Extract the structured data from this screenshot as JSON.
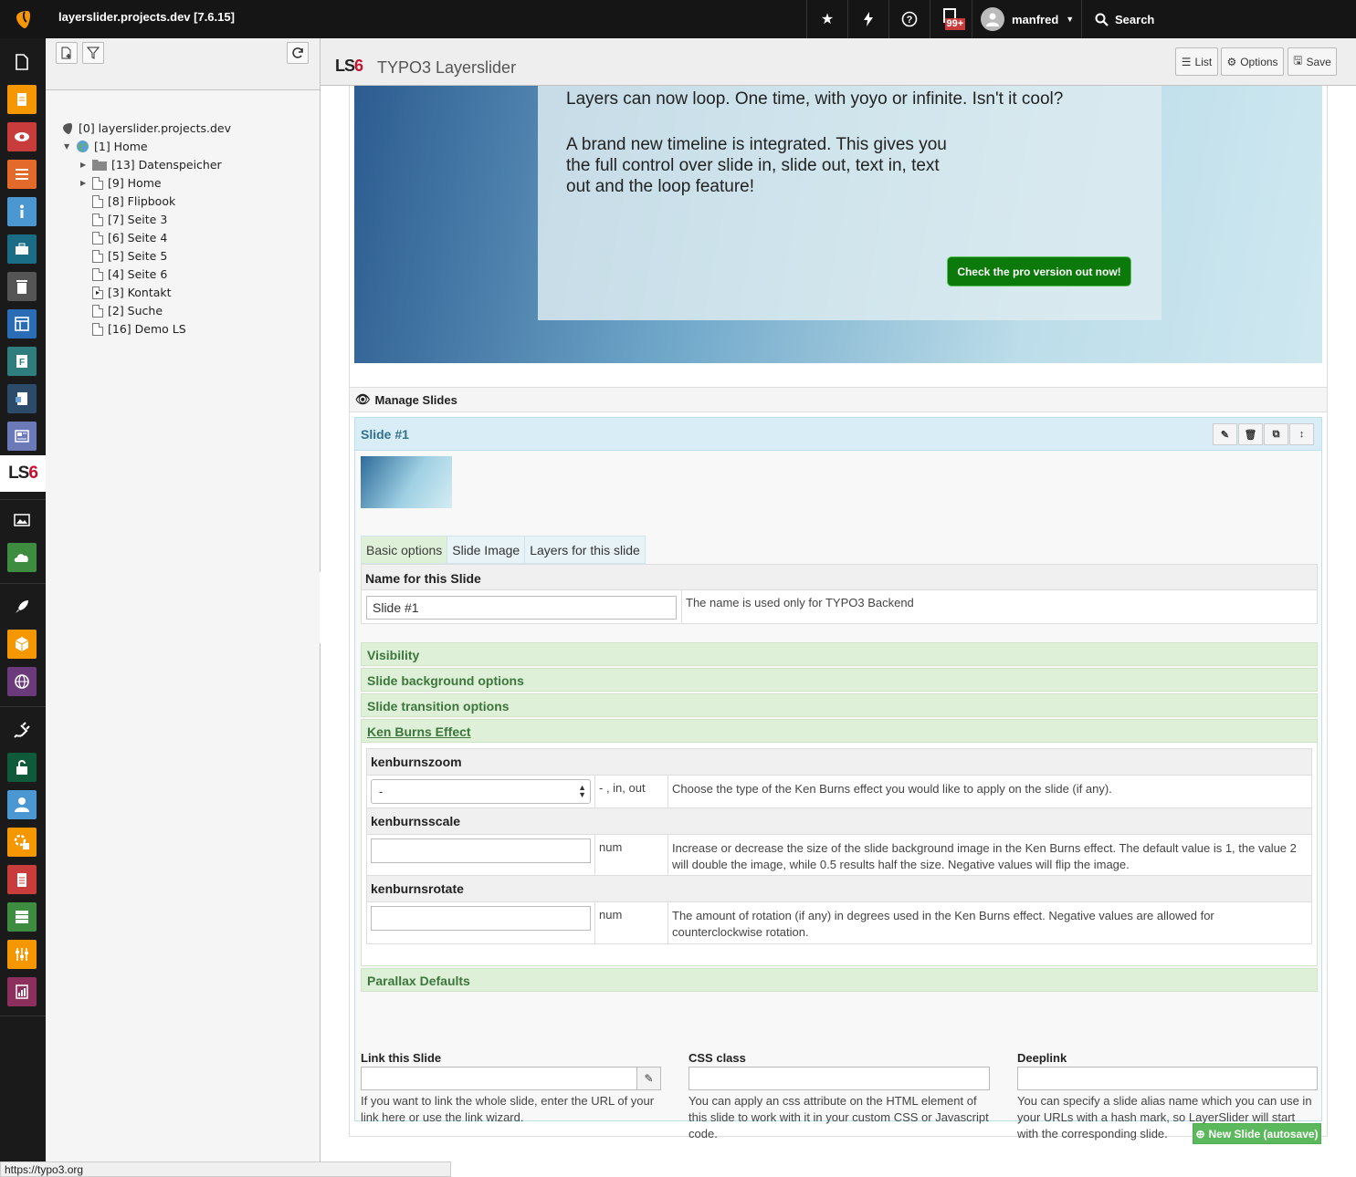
{
  "topbar": {
    "site_title": "layerslider.projects.dev [7.6.15]",
    "bookmark_icon": "star-icon",
    "cache_icon": "bolt-icon",
    "help_icon": "question-icon",
    "system_badge": "99+",
    "user_name": "manfred",
    "search_label": "Search"
  },
  "pagetree": {
    "root": "[0] layerslider.projects.dev",
    "items": [
      "[1] Home",
      "[13] Datenspeicher",
      "[9] Home",
      "[8] Flipbook",
      "[7] Seite 3",
      "[6] Seite 4",
      "[5] Seite 5",
      "[4] Seite 6",
      "[3] Kontakt",
      "[2] Suche",
      "[16] Demo LS"
    ]
  },
  "docheader": {
    "module_logo": "LS",
    "module_logo_num": "6",
    "title": "TYPO3 Layerslider",
    "list_label": "List",
    "options_label": "Options",
    "save_label": "Save"
  },
  "preview": {
    "text1": "Layers can now loop. One time, with yoyo or infinite. Isn't it cool?",
    "text2": "A brand new timeline is integrated. This gives you the full control over slide in, slide out, text in, text out and the loop feature!",
    "cta": "Check the pro version out now!"
  },
  "manage": {
    "title": "Manage Slides",
    "slide_title": "Slide #1",
    "tabs": [
      "Basic options",
      "Slide Image",
      "Layers for this slide"
    ],
    "name_label": "Name for this Slide",
    "name_value": "Slide #1",
    "name_help": "The name is used only for TYPO3 Backend",
    "sections": {
      "visibility": "Visibility",
      "background": "Slide background options",
      "transition": "Slide transition options",
      "kenburns": "Ken Burns Effect",
      "parallax": "Parallax Defaults"
    },
    "kenburns": {
      "zoom_label": "kenburnszoom",
      "zoom_value": "-",
      "zoom_unit": "- , in, out",
      "zoom_desc": "Choose the type of the Ken Burns effect you would like to apply on the slide (if any).",
      "scale_label": "kenburnsscale",
      "scale_unit": "num",
      "scale_desc": "Increase or decrease the size of the slide background image in the Ken Burns effect. The default value is 1, the value 2 will double the image, while 0.5 results half the size. Negative values will flip the image.",
      "rotate_label": "kenburnsrotate",
      "rotate_unit": "num",
      "rotate_desc": "The amount of rotation (if any) in degrees used in the Ken Burns effect. Negative values are allowed for counterclockwise rotation."
    },
    "footer": {
      "link_label": "Link this Slide",
      "link_help": "If you want to link the whole slide, enter the URL of your link here or use the link wizard.",
      "css_label": "CSS class",
      "css_help": "You can apply an css attribute on the HTML element of this slide to work with it in your custom CSS or Javascript code.",
      "deeplink_label": "Deeplink",
      "deeplink_help": "You can specify a slide alias name which you can use in your URLs with a hash mark, so LayerSlider will start with the corresponding slide."
    },
    "new_slide": "New Slide (autosave)"
  },
  "statusbar": {
    "url": "https://typo3.org"
  },
  "colors": {
    "brand_orange": "#f49700",
    "topbar_bg": "#151515",
    "accordion_green": "#dff0d8",
    "slide_header_blue": "#d9edf7",
    "cta_green": "#0b7a0b"
  }
}
